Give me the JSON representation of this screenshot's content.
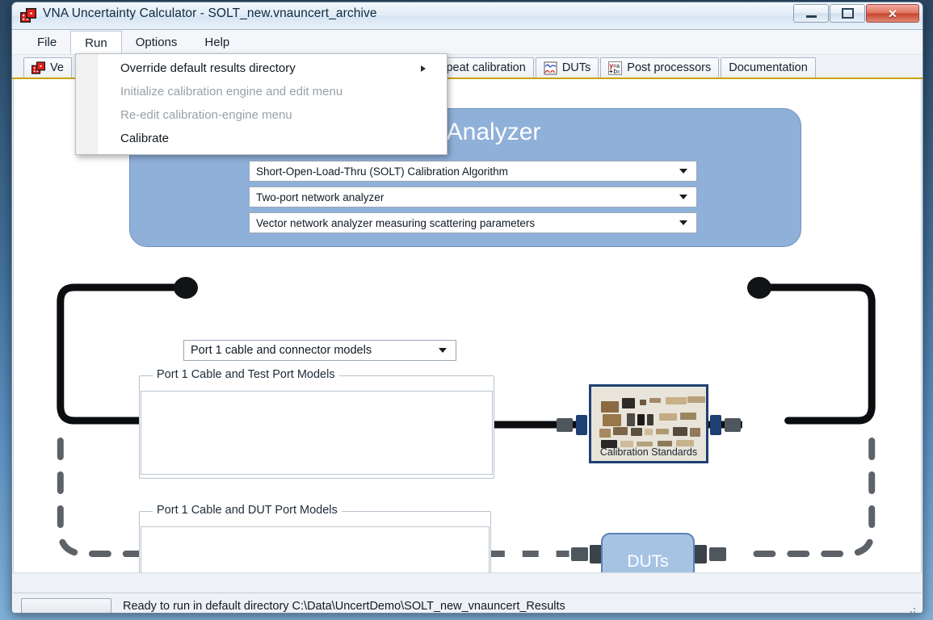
{
  "window": {
    "title": "VNA Uncertainty Calculator - SOLT_new.vnauncert_archive",
    "icon": "dice-app-icon",
    "minimize_label": "Minimize",
    "maximize_label": "Maximize",
    "close_label": "Close"
  },
  "menubar": {
    "items": [
      {
        "label": "File",
        "open": false
      },
      {
        "label": "Run",
        "open": true
      },
      {
        "label": "Options",
        "open": false
      },
      {
        "label": "Help",
        "open": false
      }
    ]
  },
  "run_menu": {
    "items": [
      {
        "label": "Override default results directory",
        "disabled": false,
        "submenu": true
      },
      {
        "label": "Initialize calibration engine and edit menu",
        "disabled": true,
        "submenu": false
      },
      {
        "label": "Re-edit calibration-engine menu",
        "disabled": true,
        "submenu": false
      },
      {
        "label": "Calibrate",
        "disabled": false,
        "submenu": false
      }
    ]
  },
  "tabs": [
    {
      "label": "Ve",
      "icon": "dice-icon",
      "selected": true
    },
    {
      "label": "Repeat calibration",
      "icon": "yellow-bars-icon",
      "selected": false
    },
    {
      "label": "DUTs",
      "icon": "waveform-plot-icon",
      "selected": false
    },
    {
      "label": "Post processors",
      "icon": "formula-y-eq-a-plus-bx-icon",
      "selected": false
    },
    {
      "label": "Documentation",
      "icon": "none",
      "selected": false
    }
  ],
  "vna_panel": {
    "title": "work Analyzer",
    "combos": [
      {
        "name": "algorithm",
        "value": "Short-Open-Load-Thru (SOLT) Calibration Algorithm"
      },
      {
        "name": "analyzer-type",
        "value": "Two-port network analyzer"
      },
      {
        "name": "measurement",
        "value": "Vector network analyzer measuring scattering parameters"
      }
    ]
  },
  "port_selector": {
    "value": "Port 1 cable and connector models"
  },
  "groupboxes": [
    {
      "name": "test-port-models",
      "title": "Port 1 Cable and Test Port Models",
      "content": ""
    },
    {
      "name": "dut-port-models",
      "title": "Port 1 Cable and DUT Port Models",
      "content": ""
    }
  ],
  "calibration_standards": {
    "caption": "Calibration Standards"
  },
  "dut": {
    "label": "DUTs"
  },
  "statusbar": {
    "text": "Ready to run in default directory C:\\Data\\UncertDemo\\SOLT_new_vnauncert_Results",
    "progress_value": ""
  },
  "colors": {
    "panel_blue": "#8fb0d9",
    "dut_blue": "#a7c3e4",
    "tab_underline": "#c8a300",
    "cal_border": "#1f3f73",
    "close_red": "#c9452f"
  }
}
